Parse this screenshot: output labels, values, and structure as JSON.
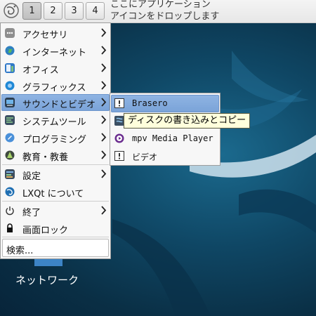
{
  "panel": {
    "workspaces": [
      "1",
      "2",
      "3",
      "4"
    ],
    "active_workspace": "1",
    "hint_line1": "ここにアプリケーション",
    "hint_line2": "アイコンをドロップします"
  },
  "main_menu": {
    "items": [
      {
        "label": "アクセサリ",
        "icon": "accessories-icon",
        "has_submenu": true
      },
      {
        "label": "インターネット",
        "icon": "globe-icon",
        "has_submenu": true
      },
      {
        "label": "オフィス",
        "icon": "office-icon",
        "has_submenu": true
      },
      {
        "label": "グラフィックス",
        "icon": "graphics-icon",
        "has_submenu": true
      },
      {
        "label": "サウンドとビデオ",
        "icon": "multimedia-icon",
        "has_submenu": true,
        "highlighted": true
      },
      {
        "label": "システムツール",
        "icon": "system-tools-icon",
        "has_submenu": true
      },
      {
        "label": "プログラミング",
        "icon": "programming-icon",
        "has_submenu": true
      },
      {
        "label": "教育・教養",
        "icon": "education-icon",
        "has_submenu": true
      },
      {
        "label": "設定",
        "icon": "settings-icon",
        "has_submenu": true
      },
      {
        "label": "LXQt について",
        "icon": "lxqt-about-icon",
        "has_submenu": false
      },
      {
        "label": "終了",
        "icon": "power-icon",
        "has_submenu": true
      },
      {
        "label": "画面ロック",
        "icon": "lock-icon",
        "has_submenu": false
      }
    ],
    "search_placeholder": "検索..."
  },
  "submenu": {
    "items": [
      {
        "label": "Brasero",
        "icon": "brasero-icon",
        "highlighted": true
      },
      {
        "label": "",
        "icon": "multimedia-app-icon"
      },
      {
        "label": "mpv Media Player",
        "icon": "mpv-icon"
      },
      {
        "label": "ビデオ",
        "icon": "video-icon"
      }
    ]
  },
  "tooltip": {
    "text": "ディスクの書き込みとコピー"
  },
  "desktop": {
    "icon_label": "ネットワーク"
  },
  "colors": {
    "highlight": "#7aa3d8",
    "tooltip_bg": "#ffffdc",
    "desktop_bg": "#0f4765"
  }
}
